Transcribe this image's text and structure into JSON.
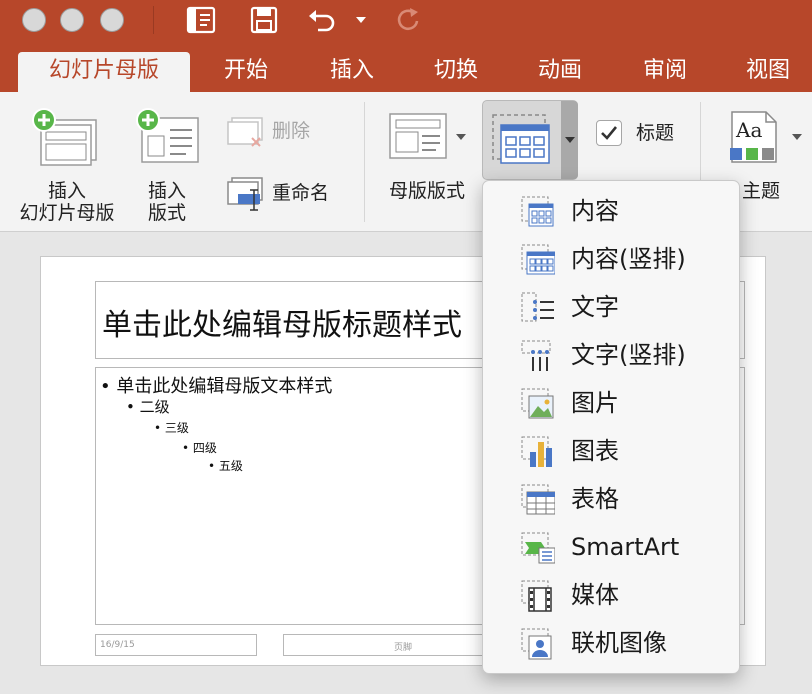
{
  "window": {
    "buttons": [
      "close",
      "minimize",
      "zoom"
    ]
  },
  "toolbar": {
    "icons": [
      "layout-panel-icon",
      "save-icon",
      "undo-icon",
      "redo-icon"
    ]
  },
  "tabs": [
    {
      "label": "幻灯片母版",
      "active": true
    },
    {
      "label": "开始"
    },
    {
      "label": "插入"
    },
    {
      "label": "切换"
    },
    {
      "label": "动画"
    },
    {
      "label": "审阅"
    },
    {
      "label": "视图"
    }
  ],
  "ribbon": {
    "insert_master_line1": "插入",
    "insert_master_line2": "幻灯片母版",
    "insert_layout_line1": "插入",
    "insert_layout_line2": "版式",
    "delete": "删除",
    "rename": "重命名",
    "master_layout": "母版版式",
    "title_checkbox": "标题",
    "title_checked": true,
    "theme": "主题",
    "theme_icon_text": "Aa"
  },
  "slide": {
    "title": "单击此处编辑母版标题样式",
    "levels": [
      "• 单击此处编辑母版文本样式",
      "• 二级",
      "• 三级",
      "• 四级",
      "• 五级"
    ],
    "date": "16/9/15",
    "footer": "页脚"
  },
  "insert_placeholder_menu": {
    "items": [
      {
        "label": "内容",
        "icon": "content-grid-icon"
      },
      {
        "label": "内容(竖排)",
        "icon": "content-vertical-icon"
      },
      {
        "label": "文字",
        "icon": "text-list-icon"
      },
      {
        "label": "文字(竖排)",
        "icon": "text-vertical-icon"
      },
      {
        "label": "图片",
        "icon": "picture-icon"
      },
      {
        "label": "图表",
        "icon": "chart-icon"
      },
      {
        "label": "表格",
        "icon": "table-icon"
      },
      {
        "label": "SmartArt",
        "icon": "smartart-icon"
      },
      {
        "label": "媒体",
        "icon": "media-film-icon"
      },
      {
        "label": "联机图像",
        "icon": "online-image-icon"
      }
    ]
  },
  "colors": {
    "accent": "#b7472a",
    "ribbon_bg": "#f3f3f3",
    "icon_blue": "#4a77c6",
    "plus_green": "#58b649"
  }
}
